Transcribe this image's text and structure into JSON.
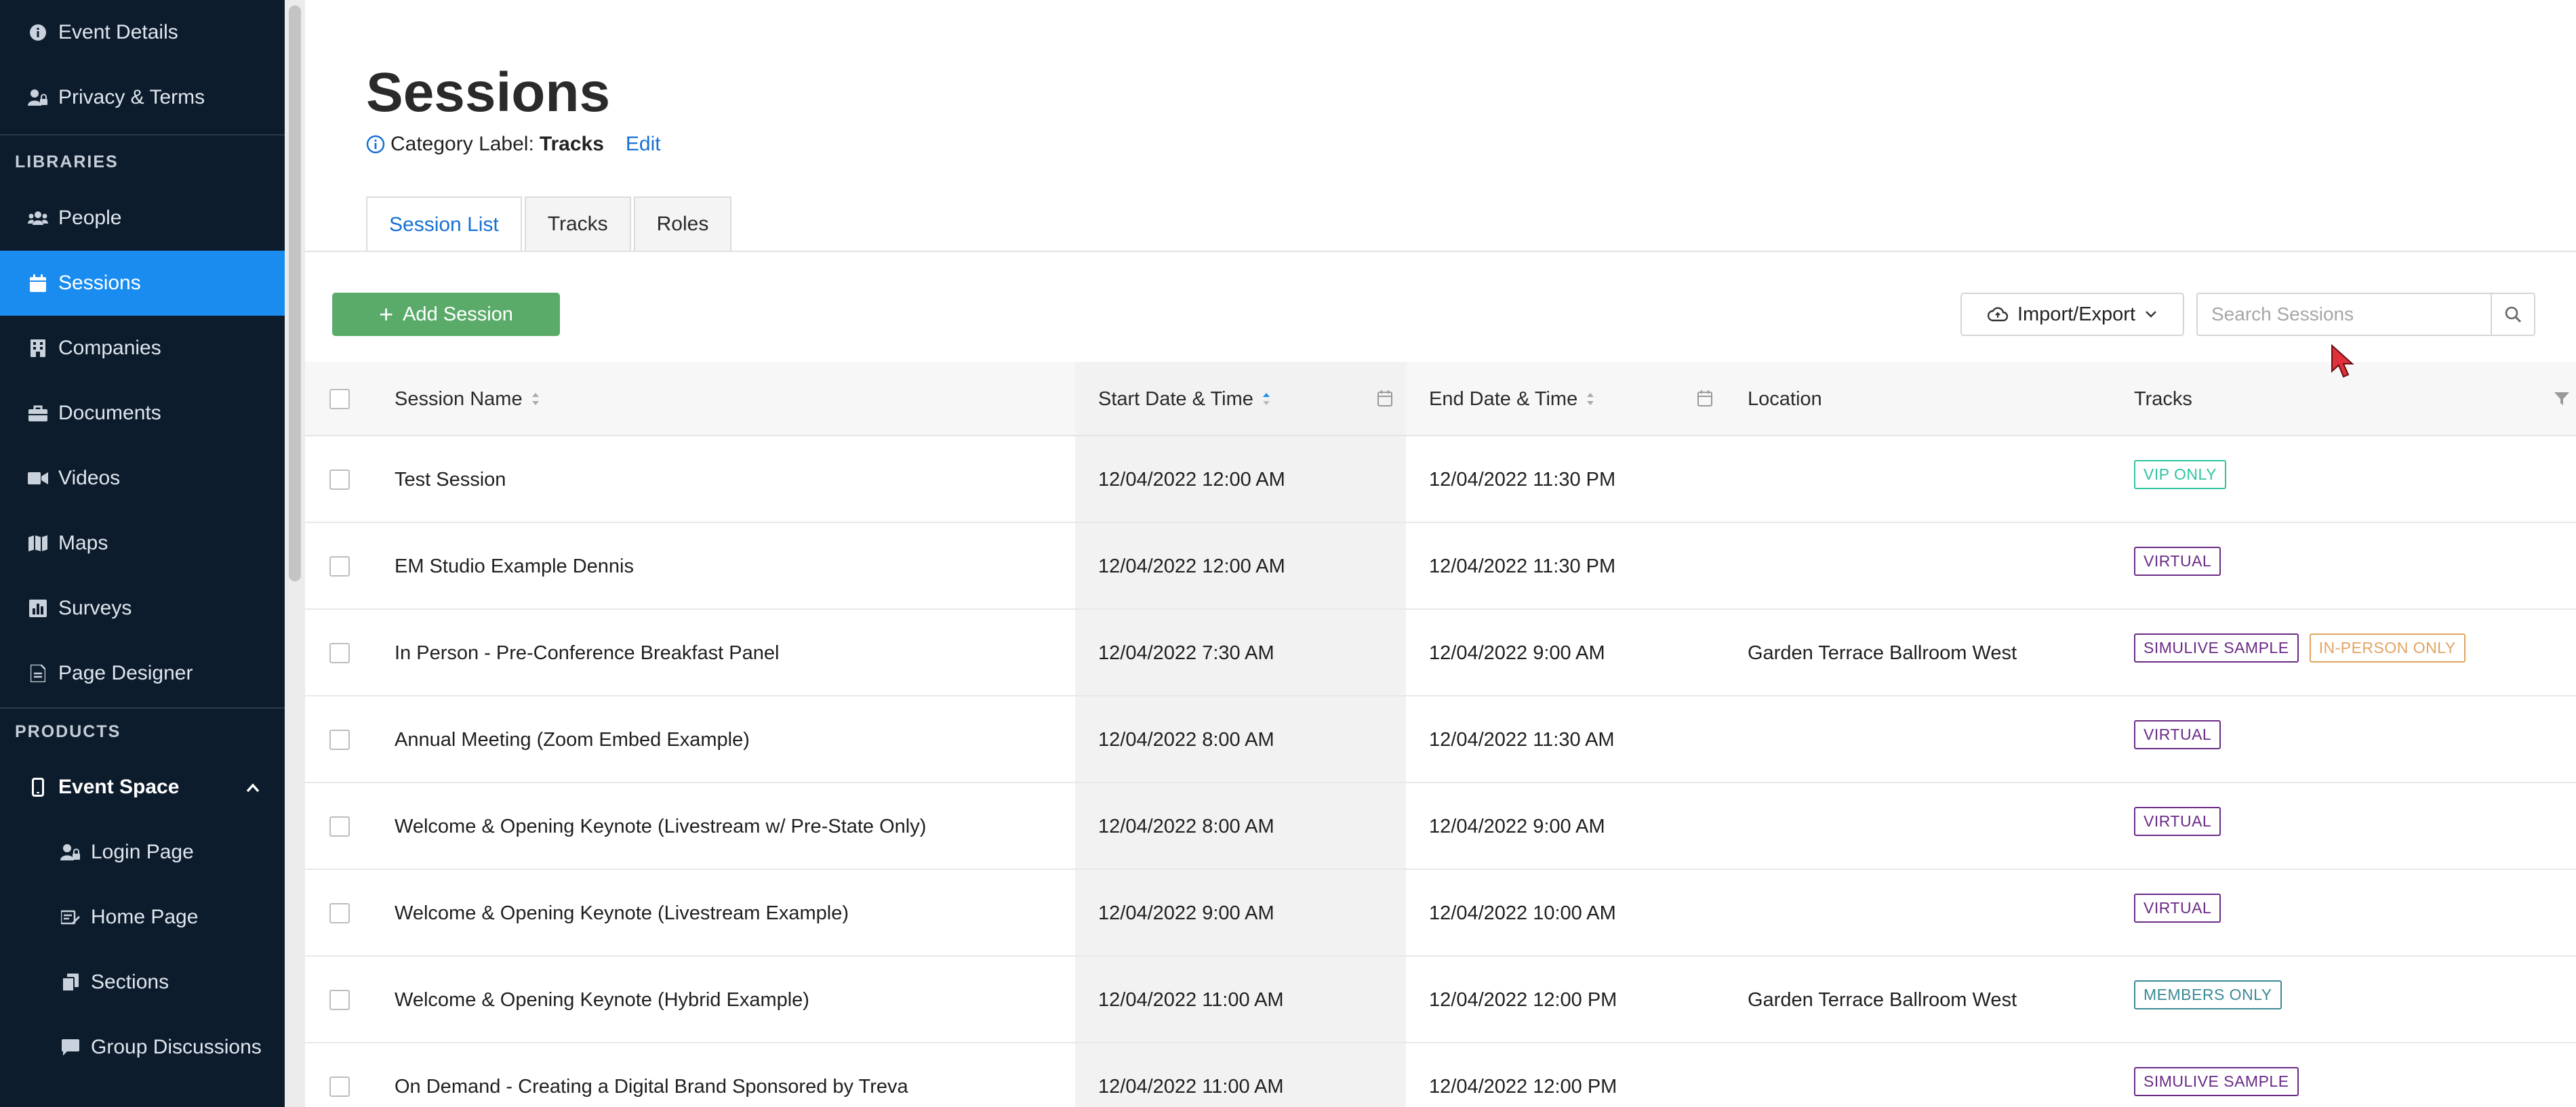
{
  "sidebar": {
    "items_top": [
      {
        "label": "Event Details",
        "icon": "info-circle-icon"
      },
      {
        "label": "Privacy & Terms",
        "icon": "user-lock-icon"
      }
    ],
    "libraries_heading": "LIBRARIES",
    "libraries": [
      {
        "label": "People",
        "icon": "people-icon"
      },
      {
        "label": "Sessions",
        "icon": "calendar-icon",
        "active": true
      },
      {
        "label": "Companies",
        "icon": "building-icon"
      },
      {
        "label": "Documents",
        "icon": "briefcase-icon"
      },
      {
        "label": "Videos",
        "icon": "video-camera-icon"
      },
      {
        "label": "Maps",
        "icon": "map-icon"
      },
      {
        "label": "Surveys",
        "icon": "chart-icon"
      },
      {
        "label": "Page Designer",
        "icon": "page-icon"
      }
    ],
    "products_heading": "PRODUCTS",
    "products_parent": {
      "label": "Event Space",
      "icon": "mobile-icon",
      "expanded": true
    },
    "products_children": [
      {
        "label": "Login Page",
        "icon": "user-lock-icon"
      },
      {
        "label": "Home Page",
        "icon": "home-icon"
      },
      {
        "label": "Sections",
        "icon": "copy-icon"
      },
      {
        "label": "Group Discussions",
        "icon": "chat-icon"
      }
    ]
  },
  "page": {
    "title": "Sessions",
    "category_prefix": "Category Label:",
    "category_value": "Tracks",
    "edit_label": "Edit"
  },
  "tabs": [
    {
      "label": "Session List",
      "active": true
    },
    {
      "label": "Tracks"
    },
    {
      "label": "Roles"
    }
  ],
  "toolbar": {
    "add_label": "Add Session",
    "import_export_label": "Import/Export",
    "search_placeholder": "Search Sessions"
  },
  "table": {
    "columns": {
      "name": "Session Name",
      "start": "Start Date & Time",
      "end": "End Date & Time",
      "location": "Location",
      "tracks": "Tracks"
    },
    "rows": [
      {
        "name": "Test Session",
        "start": "12/04/2022 12:00 AM",
        "end": "12/04/2022 11:30 PM",
        "location": "",
        "tags": [
          {
            "label": "VIP ONLY",
            "color": "#2ec4a0"
          }
        ]
      },
      {
        "name": "EM Studio Example Dennis",
        "start": "12/04/2022 12:00 AM",
        "end": "12/04/2022 11:30 PM",
        "location": "",
        "tags": [
          {
            "label": "VIRTUAL",
            "color": "#6a2a86"
          }
        ]
      },
      {
        "name": "In Person - Pre-Conference Breakfast Panel",
        "start": "12/04/2022 7:30 AM",
        "end": "12/04/2022 9:00 AM",
        "location": "Garden Terrace Ballroom West",
        "tags": [
          {
            "label": "SIMULIVE SAMPLE",
            "color": "#6a2a86"
          },
          {
            "label": "IN-PERSON ONLY",
            "color": "#e2a462"
          }
        ]
      },
      {
        "name": "Annual Meeting (Zoom Embed Example)",
        "start": "12/04/2022 8:00 AM",
        "end": "12/04/2022 11:30 AM",
        "location": "",
        "tags": [
          {
            "label": "VIRTUAL",
            "color": "#6a2a86"
          }
        ]
      },
      {
        "name": "Welcome & Opening Keynote (Livestream w/ Pre-State Only)",
        "start": "12/04/2022 8:00 AM",
        "end": "12/04/2022 9:00 AM",
        "location": "",
        "tags": [
          {
            "label": "VIRTUAL",
            "color": "#6a2a86"
          }
        ]
      },
      {
        "name": "Welcome & Opening Keynote (Livestream Example)",
        "start": "12/04/2022 9:00 AM",
        "end": "12/04/2022 10:00 AM",
        "location": "",
        "tags": [
          {
            "label": "VIRTUAL",
            "color": "#6a2a86"
          }
        ]
      },
      {
        "name": "Welcome & Opening Keynote (Hybrid Example)",
        "start": "12/04/2022 11:00 AM",
        "end": "12/04/2022 12:00 PM",
        "location": "Garden Terrace Ballroom West",
        "tags": [
          {
            "label": "MEMBERS ONLY",
            "color": "#3a8a96"
          }
        ]
      },
      {
        "name": "On Demand - Creating a Digital Brand Sponsored by Treva",
        "start": "12/04/2022 11:00 AM",
        "end": "12/04/2022 12:00 PM",
        "location": "",
        "tags": [
          {
            "label": "SIMULIVE SAMPLE",
            "color": "#6a2a86"
          }
        ]
      }
    ]
  },
  "colors": {
    "sidebar_bg": "#0d1c2c",
    "active_nav": "#1a8cf0",
    "primary_link": "#1670d4",
    "add_button": "#5aab6a"
  }
}
